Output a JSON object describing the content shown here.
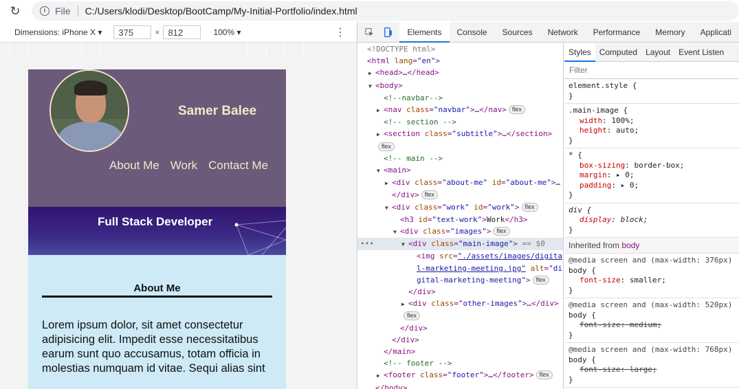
{
  "browser": {
    "protocol": "File",
    "url": "C:/Users/klodi/Desktop/BootCamp/My-Initial-Portfolio/index.html"
  },
  "device_toolbar": {
    "dimensions_label": "Dimensions: iPhone X",
    "width": "375",
    "height": "812",
    "zoom": "100%"
  },
  "site": {
    "name": "Samer Balee",
    "nav": [
      "About Me",
      "Work",
      "Contact Me"
    ],
    "subtitle": "Full Stack Developer",
    "about_title": "About Me",
    "about_text": "Lorem ipsum dolor, sit amet consectetur adipisicing elit. Impedit esse necessitatibus earum sunt quo accusamus, totam officia in molestias numquam id vitae. Sequi alias sint"
  },
  "devtools": {
    "tabs": [
      "Elements",
      "Console",
      "Sources",
      "Network",
      "Performance",
      "Memory",
      "Applicati"
    ],
    "active_tab": "Elements",
    "styles_tabs": [
      "Styles",
      "Computed",
      "Layout",
      "Event Listen"
    ],
    "filter_placeholder": "Filter",
    "inherited_label": "Inherited from",
    "inherited_tag": "body"
  },
  "colors": {
    "navbar": "#6c5a7a",
    "subtitle_bg": "#321470",
    "about_bg": "#cdeaf6",
    "accent": "#1a73e8"
  }
}
